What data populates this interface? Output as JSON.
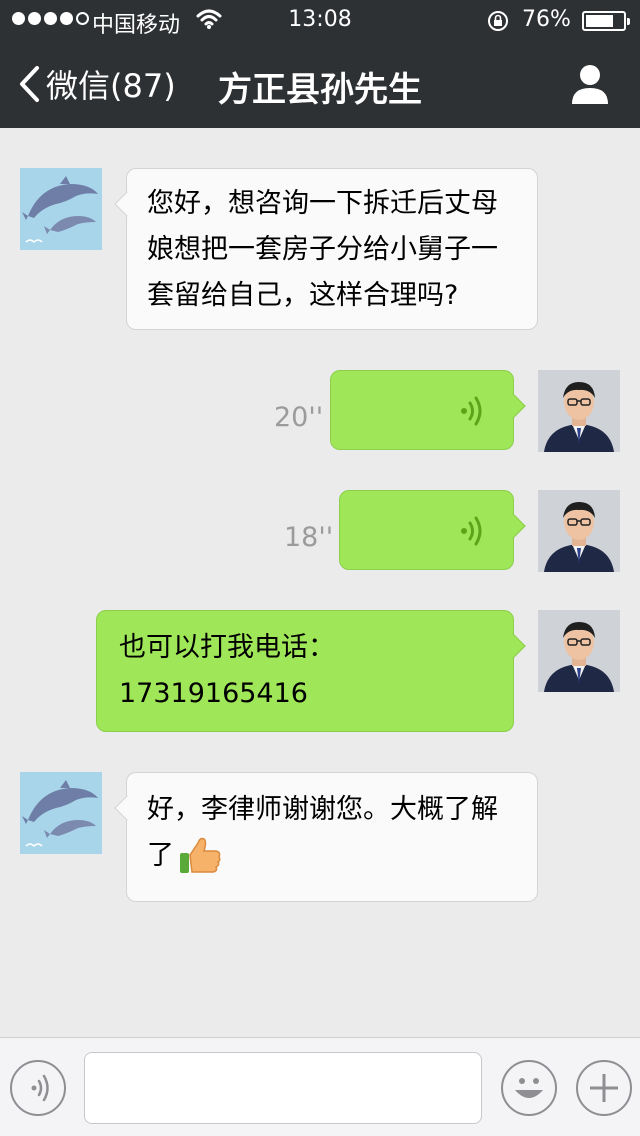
{
  "status_bar": {
    "carrier": "中国移动",
    "time": "13:08",
    "battery_percent": "76%",
    "battery_level": 0.76,
    "signal_bars_filled": 4,
    "signal_bars_total": 5
  },
  "nav": {
    "back_label": "微信(87)",
    "title": "方正县孙先生"
  },
  "messages": [
    {
      "direction": "incoming",
      "type": "text",
      "lines": [
        "您好，想咨询一下拆迁后丈母",
        "娘想把一套房子分给小舅子一",
        "套留给自己，这样合理吗?"
      ]
    },
    {
      "direction": "outgoing",
      "type": "voice",
      "duration": "20''"
    },
    {
      "direction": "outgoing",
      "type": "voice",
      "duration": "18''"
    },
    {
      "direction": "outgoing",
      "type": "text",
      "lines": [
        "也可以打我电话：",
        "17319165416"
      ]
    },
    {
      "direction": "incoming",
      "type": "text",
      "lines": [
        "好，李律师谢谢您。大概了解",
        "了"
      ],
      "emoji": "thumbs-up-icon"
    }
  ],
  "input": {
    "value": "",
    "placeholder": ""
  },
  "icons": {
    "voice_toggle": "voice-input-icon",
    "emoji": "emoji-icon",
    "more": "plus-icon",
    "profile": "person-icon",
    "back": "chevron-left-icon"
  },
  "colors": {
    "header_bg": "#2e3134",
    "chat_bg": "#ebebeb",
    "outgoing_bubble": "#9fe658",
    "incoming_bubble": "#fafafa",
    "voice_wave": "#5fa31a"
  }
}
